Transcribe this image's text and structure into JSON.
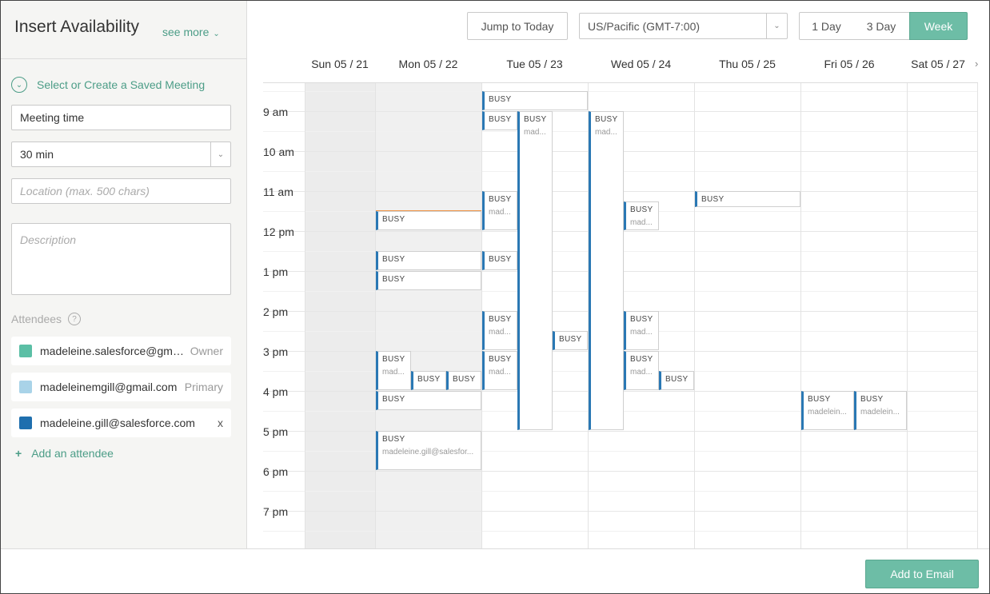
{
  "sidebar": {
    "title": "Insert Availability",
    "see_more": "see more",
    "saved_meeting": "Select or Create a Saved Meeting",
    "meeting_title": "Meeting time",
    "duration": "30 min",
    "location_placeholder": "Location (max. 500 chars)",
    "description_placeholder": "Description",
    "attendees_label": "Attendees",
    "help": "?",
    "attendees": [
      {
        "email": "madeleine.salesforce@gma...",
        "role": "Owner",
        "color": "#5bbfa5"
      },
      {
        "email": "madeleinemgill@gmail.com",
        "role": "Primary",
        "color": "#a9d3e8"
      },
      {
        "email": "madeleine.gill@salesforce.com",
        "remove": "x",
        "color": "#1f6fae"
      }
    ],
    "add_attendee": "Add an attendee",
    "plus": "+"
  },
  "toolbar": {
    "jump_today": "Jump to Today",
    "timezone": "US/Pacific (GMT-7:00)",
    "views": [
      "1 Day",
      "3 Day",
      "Week"
    ],
    "active_view": "Week"
  },
  "days": [
    "Sun 05 / 21",
    "Mon 05 / 22",
    "Tue 05 / 23",
    "Wed 05 / 24",
    "Thu 05 / 25",
    "Fri 05 / 26",
    "Sat 05 / 27"
  ],
  "times": [
    "9 am",
    "10 am",
    "11 am",
    "12 pm",
    "1 pm",
    "2 pm",
    "3 pm",
    "4 pm",
    "5 pm",
    "6 pm",
    "7 pm"
  ],
  "events": [
    {
      "title": "BUSY"
    },
    {
      "title": "BUSY"
    },
    {
      "title": "BUSY",
      "sub": "mad..."
    },
    {
      "title": "BUSY",
      "sub": "mad..."
    },
    {
      "title": "BUSY",
      "sub": "mad..."
    },
    {
      "title": "BUSY",
      "sub": "mad..."
    },
    {
      "title": "BUSY"
    },
    {
      "title": "BUSY"
    },
    {
      "title": "BUSY"
    },
    {
      "title": "BUSY"
    },
    {
      "title": "BUSY"
    },
    {
      "title": "BUSY",
      "sub": "mad..."
    },
    {
      "title": "BUSY",
      "sub": "mad..."
    },
    {
      "title": "BUSY"
    },
    {
      "title": "BUSY",
      "sub": "mad..."
    },
    {
      "title": "BUSY"
    },
    {
      "title": "BUSY"
    },
    {
      "title": "BUSY",
      "sub": "mad..."
    },
    {
      "title": "BUSY",
      "sub": "mad..."
    },
    {
      "title": "BUSY"
    },
    {
      "title": "BUSY"
    },
    {
      "title": "BUSY",
      "sub": "madeleine.gill@salesfor..."
    },
    {
      "title": "BUSY",
      "sub": "madelein..."
    },
    {
      "title": "BUSY",
      "sub": "madelein..."
    }
  ],
  "footer": {
    "add_to_email": "Add to Email"
  },
  "colors": {
    "accent": "#6dbda6",
    "event_bar": "#2a78b4",
    "now_line": "#f0964a"
  }
}
